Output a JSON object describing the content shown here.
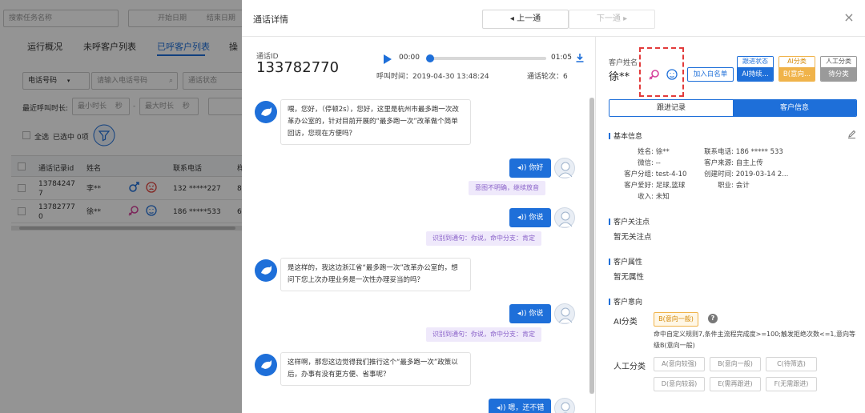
{
  "background": {
    "search_task_placeholder": "搜索任务名称",
    "start_date_placeholder": "开始日期",
    "end_date_placeholder": "结束日期",
    "tabs": [
      "运行概况",
      "未呼客户列表",
      "已呼客户列表",
      "操"
    ],
    "phone_select": "电话号码",
    "phone_search_placeholder": "请输入电话号码",
    "call_status_placeholder": "通话状态",
    "duration_label": "最近呼叫时长:",
    "min_duration_placeholder": "最小时长",
    "max_duration_placeholder": "最大时长",
    "unit_seconds": "秒",
    "select_all_label": "全选",
    "selected_count": "已选中 0项",
    "table_headers": [
      "通话记录id",
      "姓名",
      "联系电话",
      "样"
    ],
    "table_rows": [
      {
        "id": "137842477",
        "name": "李**",
        "phone": "132 *****227",
        "extra": "8"
      },
      {
        "id": "137827770",
        "name": "徐**",
        "phone": "186 *****533",
        "extra": "6"
      }
    ]
  },
  "dialog": {
    "title": "通话详情",
    "prev_label": "◂ 上一通",
    "next_label": "下一通 ▸",
    "close_label": "×"
  },
  "call": {
    "id_label": "通话ID",
    "id": "133782770",
    "time_start": "00:00",
    "time_end": "01:05",
    "progress": 0,
    "call_time": "呼叫时间：2019-04-30 13:48:24",
    "rounds": "通话轮次：6"
  },
  "chat": [
    {
      "side": "bot",
      "text": "喂，您好，（停顿2s），您好，这里是杭州市最多跑一次改革办公室的，针对目前开展的“最多跑一次”改革做个简单回访，您现在方便吗？"
    },
    {
      "side": "cust",
      "text": "你好",
      "tag": "意图不明确，继续放音"
    },
    {
      "side": "cust",
      "text": "你说",
      "tag": "识别到通句：你说，命中分支：肯定"
    },
    {
      "side": "bot",
      "text": "是这样的，我这边浙江省“最多跑一次”改革办公室的，想问下您上次办理业务是一次性办理妥当的吗？"
    },
    {
      "side": "cust",
      "text": "你说",
      "tag": "识别到通句：你说，命中分支：肯定"
    },
    {
      "side": "bot",
      "text": "这样啊，那您这边觉得我们推行这个“最多跑一次”政策以后，办事有没有更方便、省事呢？"
    },
    {
      "side": "cust",
      "text": "嗯，还不错",
      "tag": ""
    }
  ],
  "customer": {
    "name_label": "客户姓名",
    "name": "徐**",
    "whitelist_label": "加入白名单",
    "status_cards": [
      {
        "title": "跟进状态",
        "value": "AI持续...",
        "color": "#1e6fd9"
      },
      {
        "title": "AI分类",
        "value": "B(意向...",
        "color": "#f0b34a"
      },
      {
        "title": "人工分类",
        "value": "待分类",
        "color": "#9a9a9a"
      }
    ],
    "tabs": [
      "跟进记录",
      "客户信息"
    ],
    "basic_info_title": "基本信息",
    "basic_info_left": [
      {
        "k": "姓名:",
        "v": "徐**"
      },
      {
        "k": "微信:",
        "v": "--"
      },
      {
        "k": "客户分组:",
        "v": "test-4-10"
      },
      {
        "k": "客户爱好:",
        "v": "足球,篮球"
      },
      {
        "k": "收入:",
        "v": "未知"
      }
    ],
    "basic_info_right": [
      {
        "k": "联系电话:",
        "v": "186 ***** 533"
      },
      {
        "k": "客户来源:",
        "v": "自主上传"
      },
      {
        "k": "创建时间:",
        "v": "2019-03-14 2..."
      },
      {
        "k": "职业:",
        "v": "会计"
      }
    ],
    "concern_title": "客户关注点",
    "concern_text": "暂无关注点",
    "attribute_title": "客户属性",
    "attribute_text": "暂无属性",
    "intent_title": "客户意向",
    "ai_label": "AI分类",
    "ai_tag": "B(意向一般)",
    "ai_rule": "命中自定义规则7,条件主流程完成度>=100;触发拒绝次数<=1,意向等级B(意向一般)",
    "manual_label": "人工分类",
    "manual_options": [
      "A(意向较强)",
      "B(意向一般)",
      "C(待筛选)",
      "D(意向较弱)",
      "E(需再跟进)",
      "F(无需跟进)"
    ]
  }
}
